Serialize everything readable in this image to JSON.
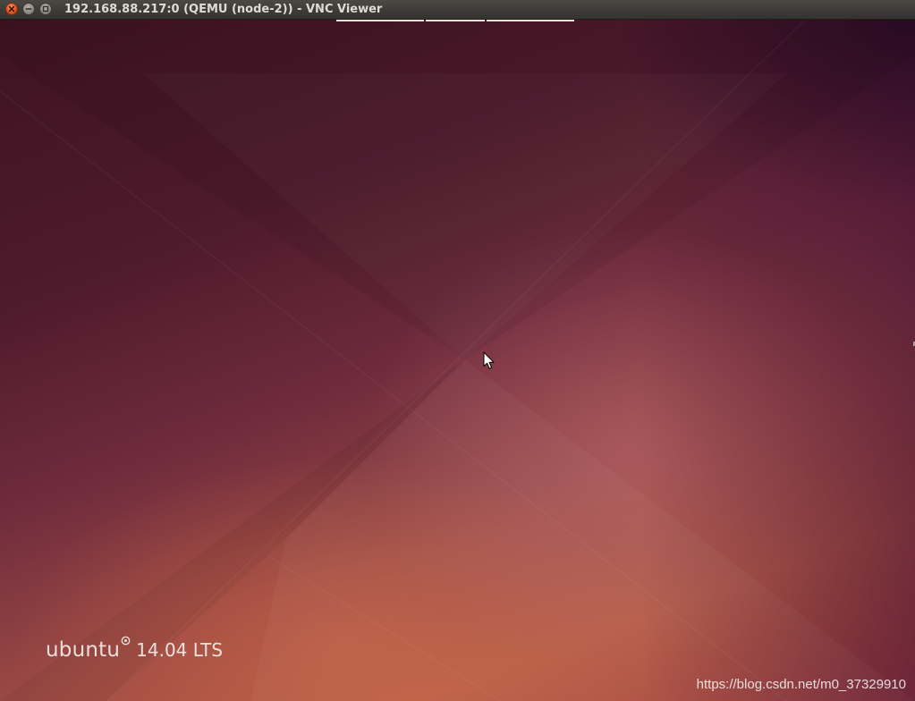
{
  "window": {
    "title": "192.168.88.217:0 (QEMU (node-2)) - VNC Viewer",
    "buttons": {
      "close_icon": "close-icon",
      "minimize_icon": "minimize-icon",
      "maximize_icon": "maximize-icon"
    }
  },
  "desktop": {
    "os_logo": {
      "name": "ubuntu",
      "version": "14.04 LTS"
    },
    "cursor": "arrow-pointer"
  },
  "watermark": "https://blog.csdn.net/m0_37329910",
  "colors": {
    "titlebar": "#3d3c38",
    "close_button": "#e2551f",
    "wallpaper_dark": "#3e1321",
    "wallpaper_warm": "#b45a44"
  }
}
